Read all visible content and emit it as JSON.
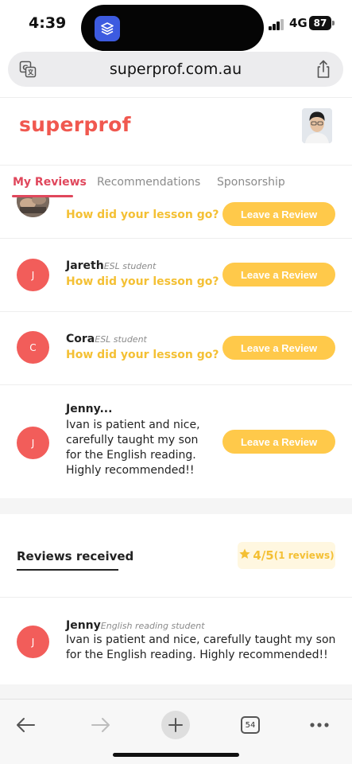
{
  "status_bar": {
    "time": "4:39",
    "network": "4G",
    "battery": "87"
  },
  "browser": {
    "url": "superprof.com.au",
    "tab_count": "54"
  },
  "site": {
    "logo": "superprof"
  },
  "tabs": [
    {
      "label": "My Reviews",
      "active": true
    },
    {
      "label": "Recommendations",
      "active": false
    },
    {
      "label": "Sponsorship",
      "active": false
    }
  ],
  "my_reviews": [
    {
      "name": "",
      "role": "",
      "avatar": "photo",
      "prompt": "How did your lesson go?",
      "button": "Leave a Review"
    },
    {
      "name": "Jareth",
      "role": "ESL student",
      "avatar": "J",
      "prompt": "How did your lesson go?",
      "button": "Leave a Review"
    },
    {
      "name": "Cora",
      "role": "ESL student",
      "avatar": "C",
      "prompt": "How did your lesson go?",
      "button": "Leave a Review"
    },
    {
      "name": "Jenny...",
      "role": "",
      "avatar": "J",
      "text": "Ivan is patient and nice, carefully taught my son for the English reading. Highly recommended!!",
      "button": "Leave a Review"
    }
  ],
  "received": {
    "title": "Reviews received",
    "rating": "4/5",
    "rating_count": "(1 reviews)",
    "review": {
      "name": "Jenny",
      "role": "English reading student",
      "avatar": "J",
      "text": "Ivan is patient and nice, carefully taught my son for the English reading. Highly recommended!!"
    }
  },
  "colors": {
    "brand": "#f0584f",
    "accent_yellow": "#ffc94a",
    "avatar_red": "#f25d5a",
    "active_tab": "#e0475c"
  }
}
